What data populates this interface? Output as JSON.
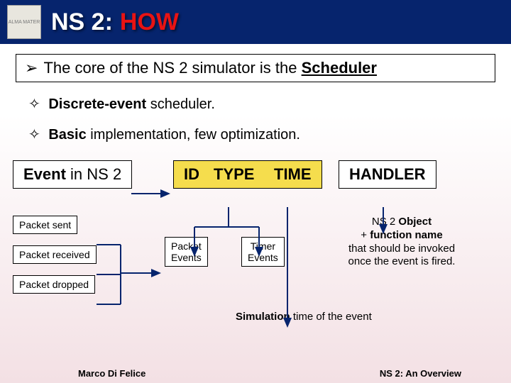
{
  "header": {
    "prefix": "NS 2:",
    "suffix": "HOW",
    "seal_alt": "university seal"
  },
  "bullet_main_pre": "The core of the NS 2 simulator is the ",
  "bullet_main_bold": "Scheduler",
  "sub1_pre": "Discrete-event",
  "sub1_rest": " scheduler.",
  "sub2_pre": "Basic",
  "sub2_rest": " implementation, few optimization.",
  "event_box_pre": "Event",
  "event_box_rest": " in NS 2",
  "fields": {
    "id": "ID",
    "type": "TYPE",
    "time": "TIME",
    "handler": "HANDLER"
  },
  "packet_list": {
    "sent": "Packet sent",
    "received": "Packet received",
    "dropped": "Packet dropped"
  },
  "packet_events": "Packet\nEvents",
  "timer_events": "Timer\nEvents",
  "handler_note_l1": "NS 2 ",
  "handler_note_b1": "Object",
  "handler_note_l2": "+ ",
  "handler_note_b2": "function name",
  "handler_note_l3": " that should be invoked once the event is fired.",
  "time_note_pre": "Simulation",
  "time_note_rest": " time of the event",
  "footer": {
    "left": "Marco Di Felice",
    "right": "NS 2: An Overview"
  }
}
